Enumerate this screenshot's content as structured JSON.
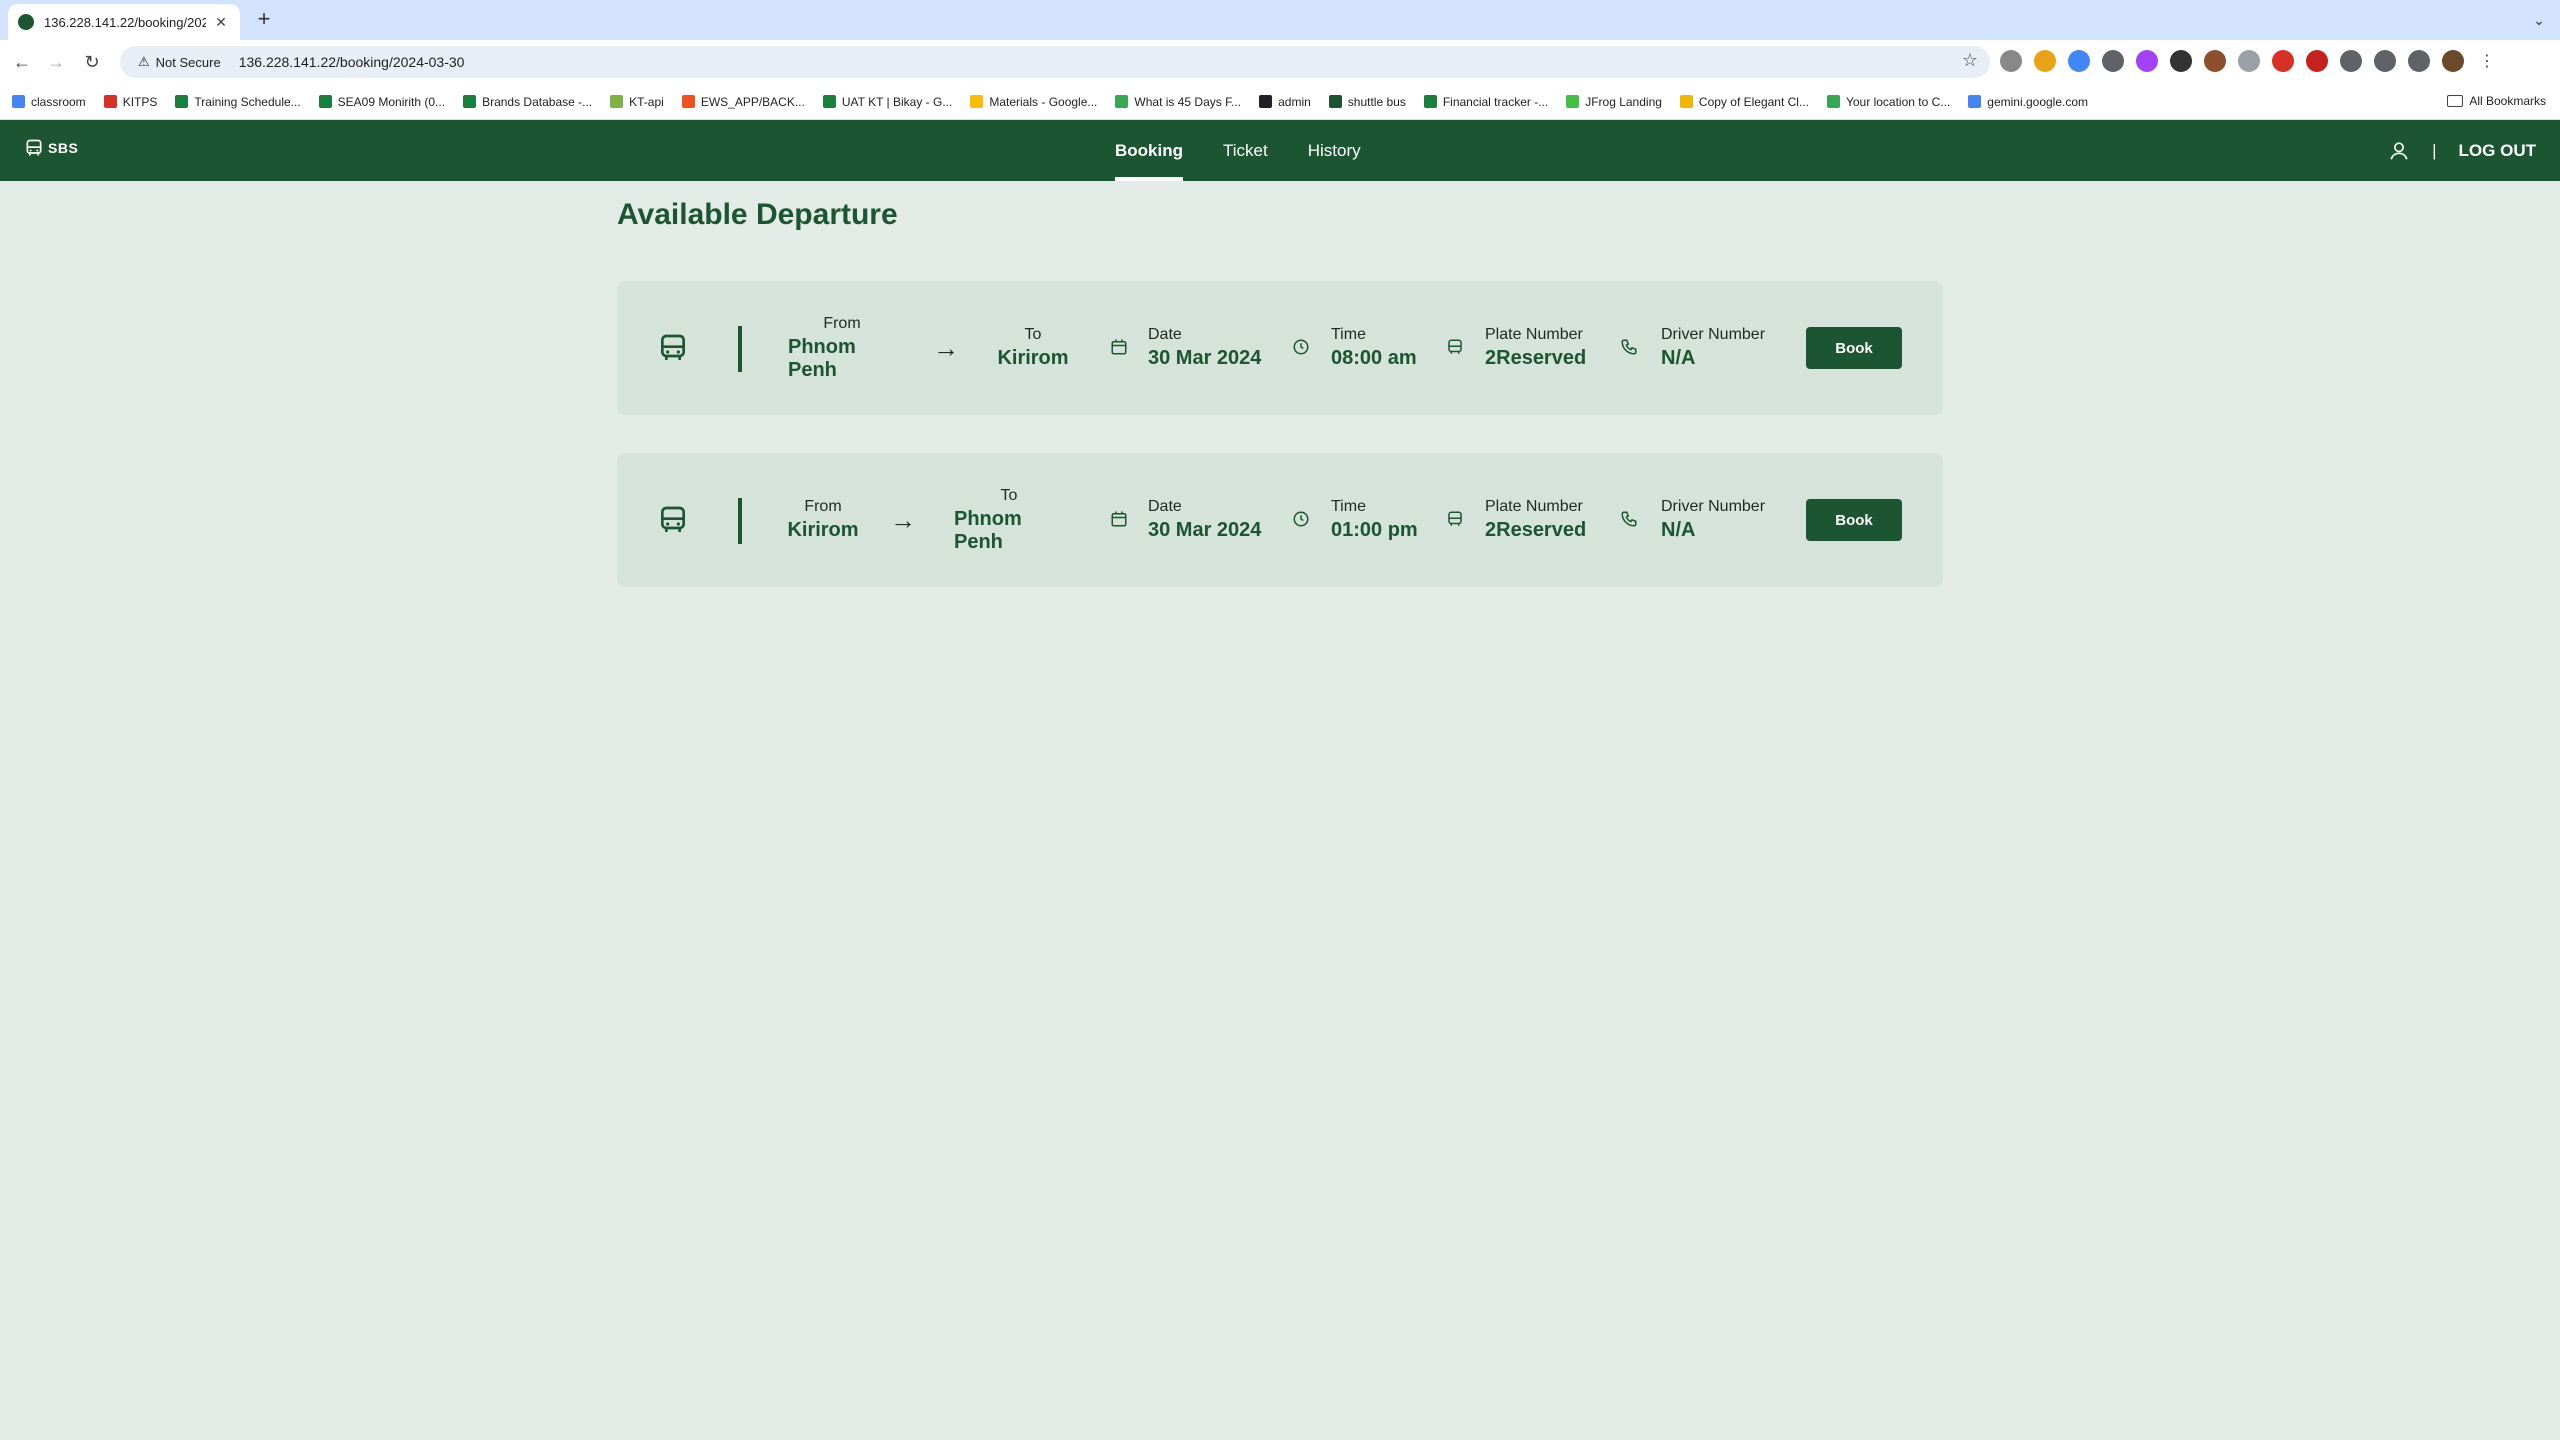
{
  "browser": {
    "tab_title": "136.228.141.22/booking/2024-03-30",
    "security_label": "Not Secure",
    "url": "136.228.141.22/booking/2024-03-30",
    "bookmarks": [
      {
        "label": "classroom",
        "color": "#4285f4"
      },
      {
        "label": "KITPS",
        "color": "#d93025"
      },
      {
        "label": "Training Schedule...",
        "color": "#188038"
      },
      {
        "label": "SEA09 Monirith (0...",
        "color": "#188038"
      },
      {
        "label": "Brands Database -...",
        "color": "#188038"
      },
      {
        "label": "KT-api",
        "color": "#7cb342"
      },
      {
        "label": "EWS_APP/BACK...",
        "color": "#f24e1e"
      },
      {
        "label": "UAT KT | Bikay - G...",
        "color": "#188038"
      },
      {
        "label": "Materials - Google...",
        "color": "#fbbc04"
      },
      {
        "label": "What is 45 Days F...",
        "color": "#34a853"
      },
      {
        "label": "admin",
        "color": "#202124"
      },
      {
        "label": "shuttle bus",
        "color": "#1b5531"
      },
      {
        "label": "Financial tracker -...",
        "color": "#188038"
      },
      {
        "label": "JFrog Landing",
        "color": "#41bf47"
      },
      {
        "label": "Copy of Elegant Cl...",
        "color": "#f4b400"
      },
      {
        "label": "Your location to C...",
        "color": "#34a853"
      },
      {
        "label": "gemini.google.com",
        "color": "#4285f4"
      }
    ],
    "all_bookmarks": "All Bookmarks"
  },
  "app": {
    "logo": "SBS",
    "nav": [
      {
        "label": "Booking",
        "active": true
      },
      {
        "label": "Ticket",
        "active": false
      },
      {
        "label": "History",
        "active": false
      }
    ],
    "separator": "|",
    "logout": "LOG OUT"
  },
  "page": {
    "title": "Available Departure",
    "labels": {
      "from": "From",
      "to": "To",
      "date": "Date",
      "time": "Time",
      "plate": "Plate Number",
      "driver": "Driver Number"
    },
    "book_label": "Book",
    "departures": [
      {
        "from": "Phnom Penh",
        "to": "Kirirom",
        "date": "30 Mar 2024",
        "time": "08:00 am",
        "plate": "2Reserved",
        "driver": "N/A"
      },
      {
        "from": "Kirirom",
        "to": "Phnom Penh",
        "date": "30 Mar 2024",
        "time": "01:00 pm",
        "plate": "2Reserved",
        "driver": "N/A"
      }
    ]
  },
  "colors": {
    "primary": "#1b5531",
    "background": "#e2ebe5",
    "card": "#d5e3da"
  }
}
